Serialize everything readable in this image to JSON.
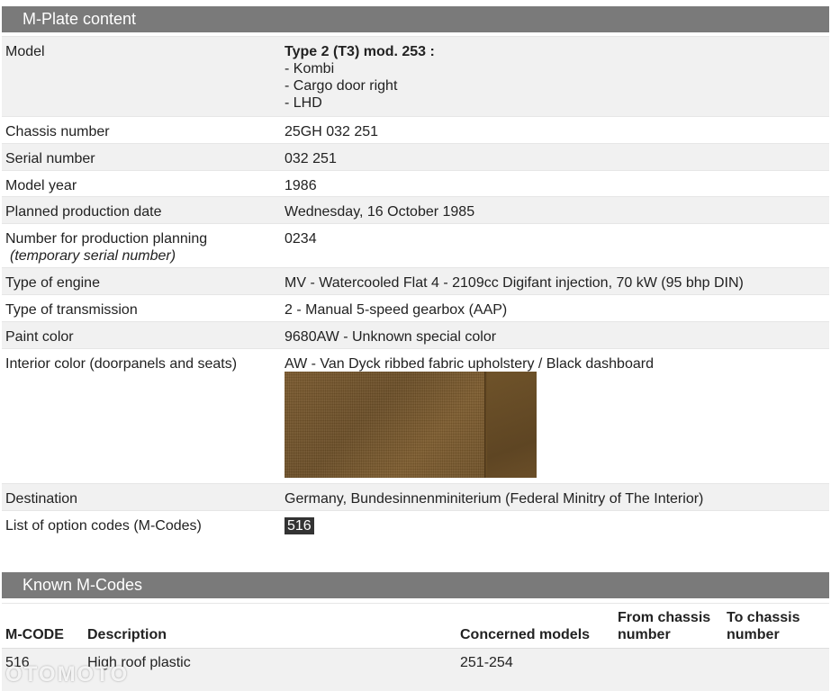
{
  "mplate": {
    "title": "M-Plate content",
    "model": {
      "label": "Model",
      "value_title": "Type 2 (T3) mod. 253 :",
      "lines": [
        "- Kombi",
        "- Cargo door right",
        "- LHD"
      ]
    },
    "chassis": {
      "label": "Chassis number",
      "value": "25GH 032 251"
    },
    "serial": {
      "label": "Serial number",
      "value": "032 251"
    },
    "model_year": {
      "label": "Model year",
      "value": "1986"
    },
    "prod_date": {
      "label": "Planned production date",
      "value": "Wednesday, 16 October 1985"
    },
    "prod_planning": {
      "label": "Number for production planning",
      "sublabel": "(temporary serial number)",
      "value": "0234"
    },
    "engine": {
      "label": "Type of engine",
      "value": "MV - Watercooled Flat 4 - 2109cc Digifant injection, 70 kW (95 bhp DIN)"
    },
    "transmission": {
      "label": "Type of transmission",
      "value": "2 - Manual 5-speed gearbox (AAP)"
    },
    "paint": {
      "label": "Paint color",
      "value": "9680AW - Unknown special color"
    },
    "interior": {
      "label": "Interior color (doorpanels and seats)",
      "value": "AW - Van Dyck ribbed fabric upholstery / Black dashboard"
    },
    "destination": {
      "label": "Destination",
      "value": "Germany, Bundesinnenminiterium (Federal Minitry of The Interior)"
    },
    "options": {
      "label": "List of option codes (M-Codes)",
      "codes": [
        "516"
      ]
    }
  },
  "known": {
    "title": "Known M-Codes",
    "headers": {
      "code": "M-CODE",
      "description": "Description",
      "models": "Concerned models",
      "from_1": "From chassis",
      "from_2": "number",
      "to_1": "To chassis",
      "to_2": "number"
    },
    "rows": [
      {
        "code": "516",
        "description": "High roof plastic",
        "models": "251-254",
        "from": "",
        "to": ""
      }
    ]
  },
  "watermark": "OTOMOTO",
  "colors": {
    "header_bar": "#7a7a7a",
    "row_alt": "#f1f1f1",
    "badge": "#333333"
  }
}
